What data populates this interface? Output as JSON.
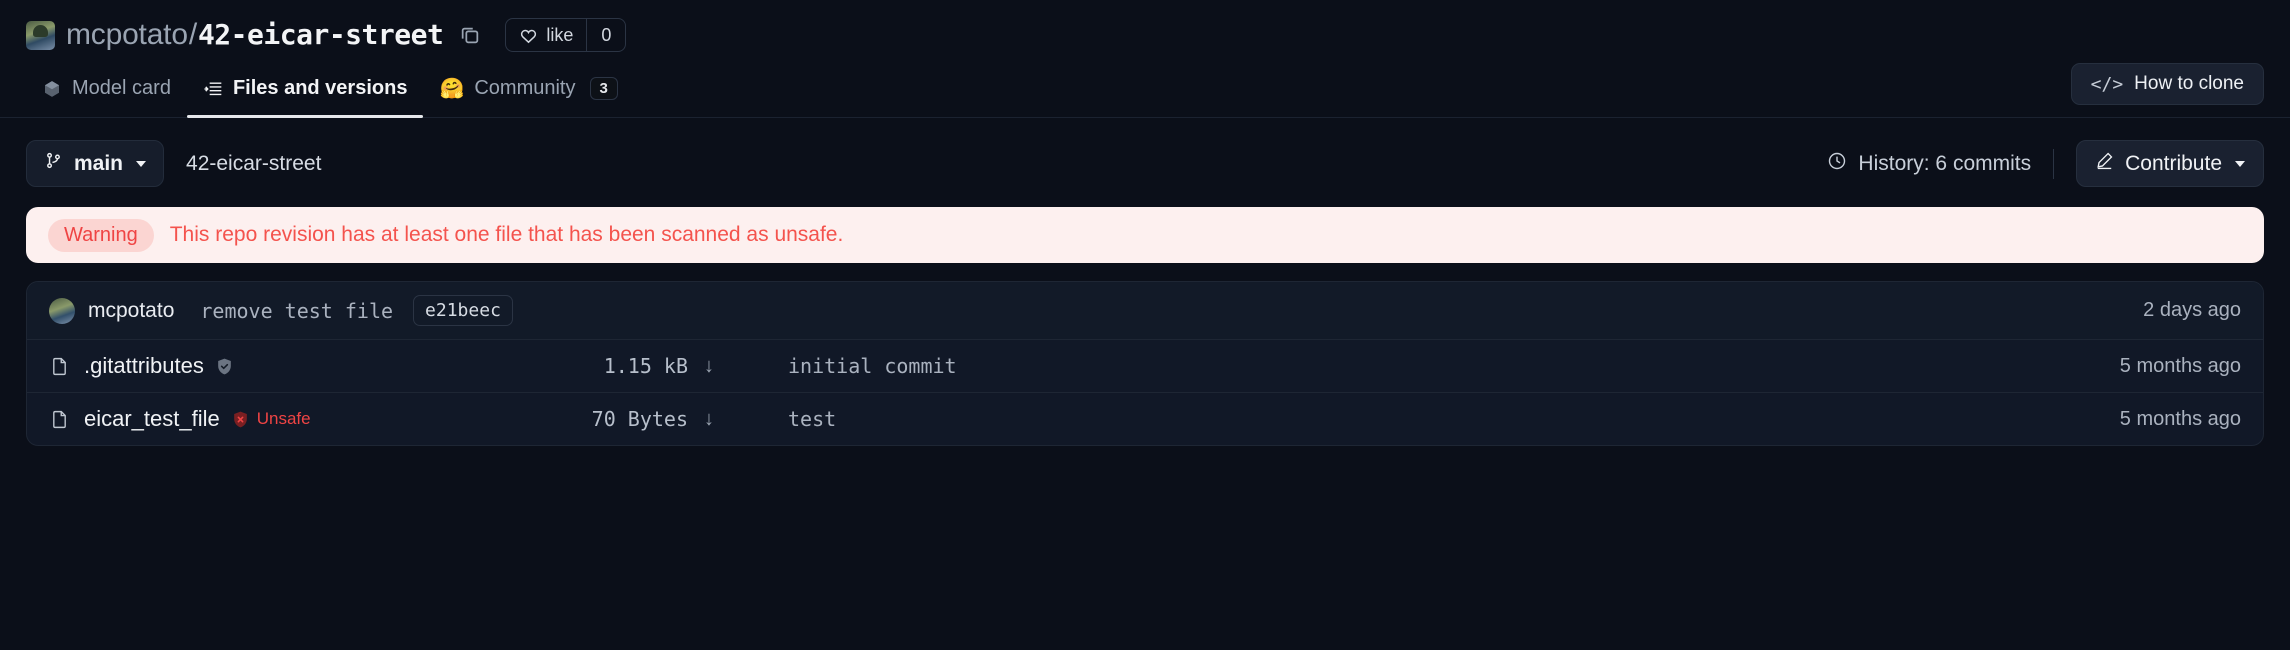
{
  "header": {
    "owner": "mcpotato",
    "separator": "/",
    "repo": "42-eicar-street",
    "copy_icon": "copy-icon",
    "like_label": "like",
    "like_count": "0",
    "avatar": "owner-avatar"
  },
  "tabs": [
    {
      "label": "Model card",
      "icon": "cube-icon",
      "badge": "",
      "active": false
    },
    {
      "label": "Files and versions",
      "icon": "file-list-icon",
      "badge": "",
      "active": true
    },
    {
      "label": "Community",
      "icon": "hugging-face-emoji",
      "badge": "3",
      "active": false
    }
  ],
  "clone": {
    "label": "How to clone",
    "icon": "code-brackets-icon"
  },
  "toolbar": {
    "branch": "main",
    "branch_icon": "git-branch-icon",
    "breadcrumb": "42-eicar-street",
    "history": "History: 6 commits",
    "history_icon": "clock-icon",
    "contribute": "Contribute",
    "contribute_icon": "pencil-icon"
  },
  "warning": {
    "tag": "Warning",
    "message": "This repo revision has at least one file that has been scanned as unsafe.",
    "bg_color": "#fdf0ef",
    "text_color": "#f4534d",
    "tag_bg_color": "#fbd5d2"
  },
  "commit": {
    "author": "mcpotato",
    "message": "remove test file",
    "hash": "e21beec",
    "time": "2 days ago"
  },
  "files": [
    {
      "name": ".gitattributes",
      "icon": "file-icon",
      "status": "safe",
      "status_label": "",
      "status_icon": "shield-check-icon",
      "size": "1.15 kB",
      "download_icon": "download-arrow-icon",
      "commit_message": "initial commit",
      "time": "5 months ago"
    },
    {
      "name": "eicar_test_file",
      "icon": "file-icon",
      "status": "unsafe",
      "status_label": "Unsafe",
      "status_icon": "shield-x-icon",
      "size": "70 Bytes",
      "download_icon": "download-arrow-icon",
      "commit_message": "test",
      "time": "5 months ago"
    }
  ]
}
